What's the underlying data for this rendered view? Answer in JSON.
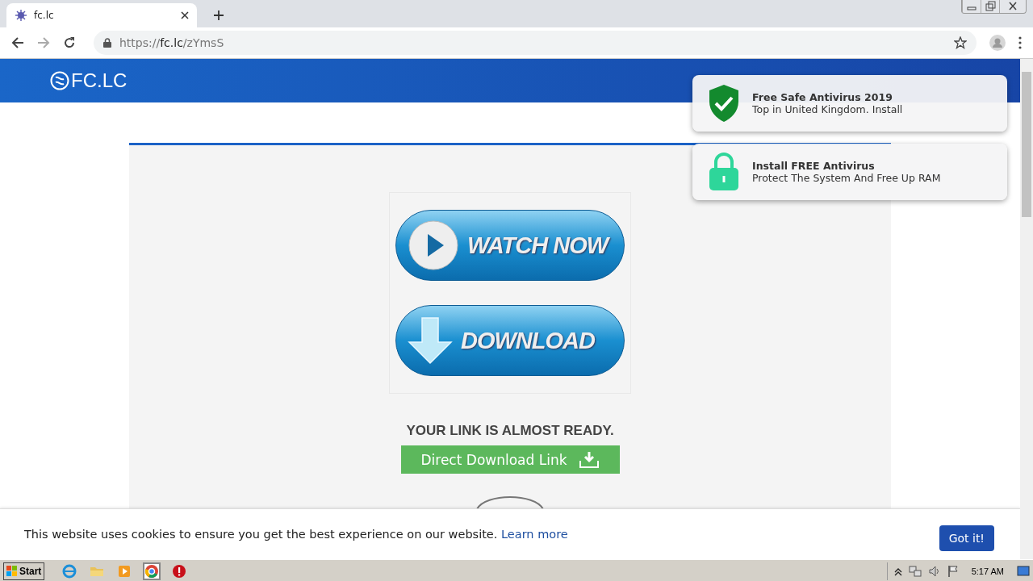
{
  "browser": {
    "tabs": [
      {
        "title": "fc.lc",
        "selected": true
      }
    ],
    "address": {
      "scheme": "https://",
      "host": "fc.lc",
      "path": "/zYmsS"
    }
  },
  "page": {
    "logo": "FC.LC",
    "media_buttons": [
      {
        "kind": "play",
        "label": "WATCH NOW"
      },
      {
        "kind": "download",
        "label": "DOWNLOAD"
      }
    ],
    "status": "YOUR LINK IS ALMOST READY.",
    "direct_link": "Direct Download Link"
  },
  "notifications": [
    {
      "kind": "shield",
      "title": "Free Safe Antivirus 2019",
      "text": "Top in United Kingdom. Install"
    },
    {
      "kind": "lock",
      "title": "Install FREE Antivirus",
      "text": "Protect The System And Free Up RAM"
    }
  ],
  "cookie_bar": {
    "text": "This website uses cookies to ensure you get the best experience on our website.",
    "link": "Learn more",
    "button": "Got it!"
  },
  "taskbar": {
    "start": "Start",
    "apps": [
      {
        "kind": "ie",
        "selected": false
      },
      {
        "kind": "folder",
        "selected": false
      },
      {
        "kind": "media",
        "selected": false
      },
      {
        "kind": "chrome",
        "selected": true
      },
      {
        "kind": "stop",
        "selected": false
      }
    ],
    "clock": "5:17 AM"
  }
}
